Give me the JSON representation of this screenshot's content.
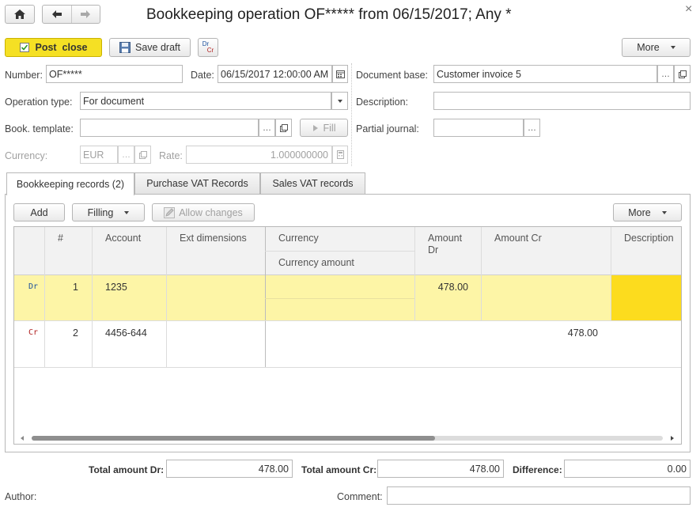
{
  "window": {
    "title": "Bookkeeping operation OF***** from 06/15/2017; Any *",
    "close_glyph": "×"
  },
  "toolbar": {
    "post_close": "Post  close",
    "save_draft": "Save draft",
    "drcr_top": "Dr",
    "drcr_bottom": "Cr",
    "more": "More"
  },
  "header": {
    "number_label": "Number:",
    "number_value": "OF*****",
    "date_label": "Date:",
    "date_value": "06/15/2017 12:00:00 AM",
    "document_base_label": "Document base:",
    "document_base_value": "Customer invoice 5",
    "operation_type_label": "Operation type:",
    "operation_type_value": "For document",
    "description_label": "Description:",
    "description_value": "",
    "book_template_label": "Book. template:",
    "book_template_value": "",
    "fill_label": "Fill",
    "partial_journal_label": "Partial journal:",
    "partial_journal_value": "",
    "currency_label": "Currency:",
    "currency_value": "EUR",
    "rate_label": "Rate:",
    "rate_value": "1.000000000"
  },
  "tabs": [
    {
      "label": "Bookkeeping records (2)",
      "active": true
    },
    {
      "label": "Purchase VAT Records",
      "active": false
    },
    {
      "label": "Sales VAT records",
      "active": false
    }
  ],
  "table_toolbar": {
    "add": "Add",
    "filling": "Filling",
    "allow_changes": "Allow changes",
    "more": "More"
  },
  "table": {
    "columns": {
      "num": "#",
      "account": "Account",
      "ext_dimensions": "Ext dimensions",
      "currency": "Currency",
      "currency_amount": "Currency amount",
      "amount_dr": "Amount Dr",
      "amount_cr": "Amount Cr",
      "description": "Description"
    },
    "rows": [
      {
        "type": "Dr",
        "num": "1",
        "account": "1235",
        "ext_dimensions": "",
        "currency": "",
        "currency_amount": "",
        "amount_dr": "478.00",
        "amount_cr": "",
        "description": ""
      },
      {
        "type": "Cr",
        "num": "2",
        "account": "4456-644",
        "ext_dimensions": "",
        "currency": "",
        "currency_amount": "",
        "amount_dr": "",
        "amount_cr": "478.00",
        "description": ""
      }
    ]
  },
  "totals": {
    "total_dr_label": "Total amount Dr:",
    "total_dr_value": "478.00",
    "total_cr_label": "Total amount Cr:",
    "total_cr_value": "478.00",
    "difference_label": "Difference:",
    "difference_value": "0.00"
  },
  "footer": {
    "author_label": "Author:",
    "comment_label": "Comment:",
    "comment_value": ""
  },
  "colors": {
    "post_button": "#f5e024",
    "selected_row": "#fdf5a6",
    "selected_cell": "#fcdc1e",
    "dr_text": "#1b4f9c",
    "cr_text": "#b02020"
  }
}
